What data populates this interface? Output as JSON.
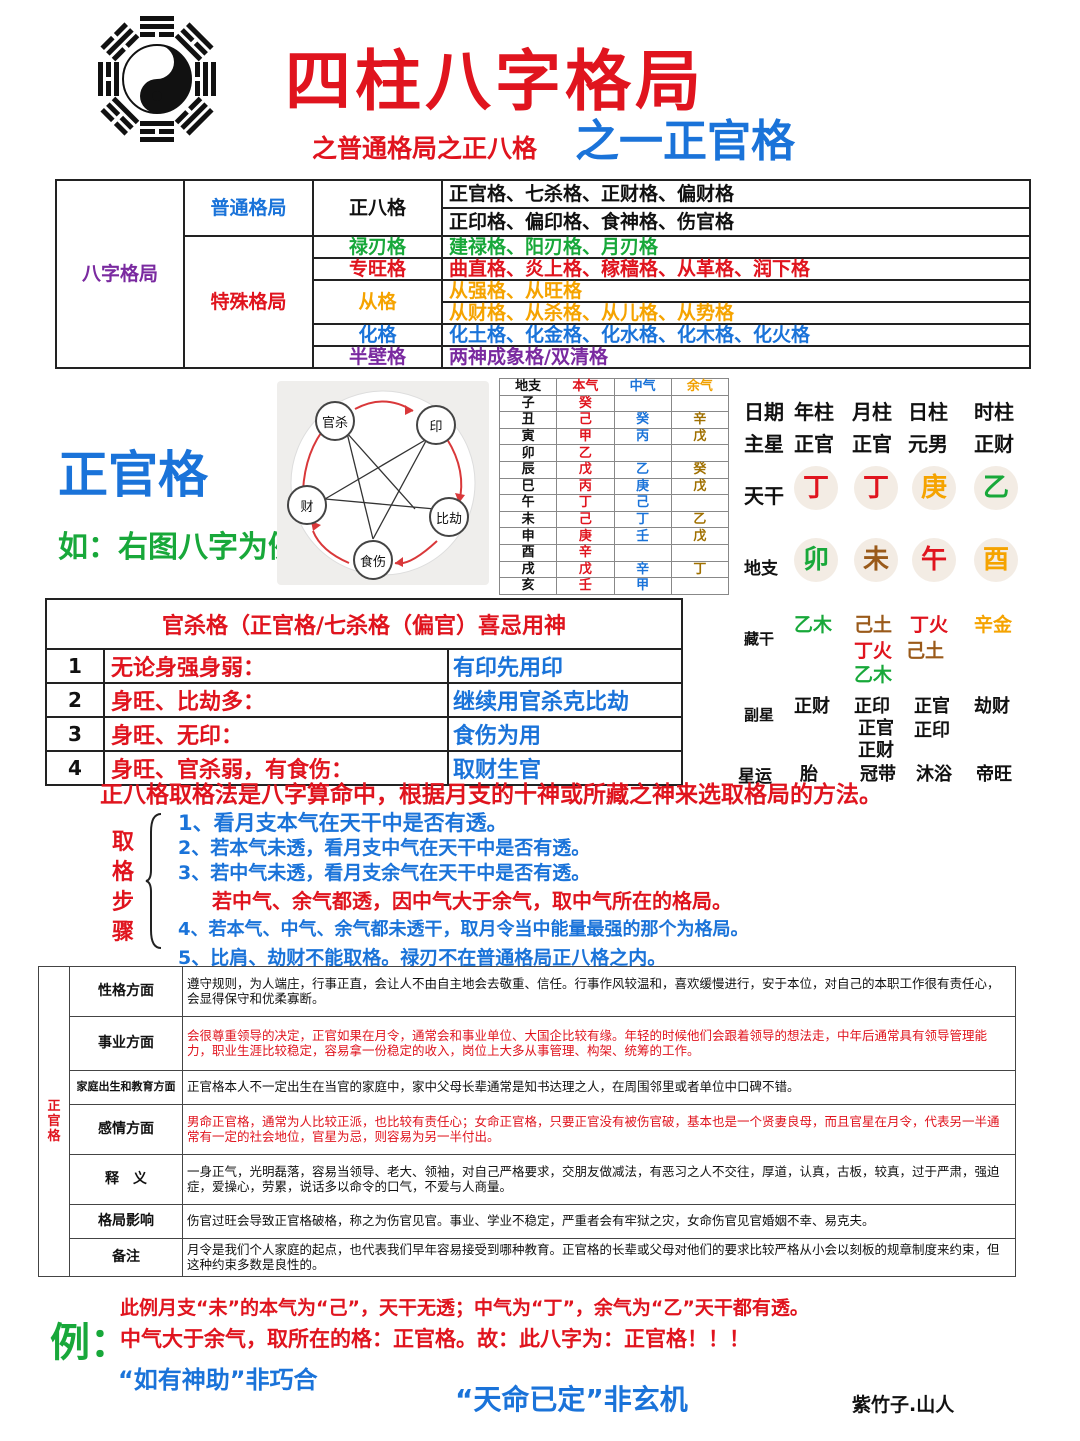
{
  "header": {
    "title": "四柱八字格局",
    "subtitle_left": "之普通格局之正八格",
    "subtitle_right": "之一正官格"
  },
  "classification": {
    "root": "八字格局",
    "ordinary": {
      "label": "普通格局",
      "sub": "正八格",
      "lines": [
        "正官格、七杀格、正财格、偏财格",
        "正印格、偏印格、食神格、伤官格"
      ]
    },
    "special": {
      "label": "特殊格局",
      "rows": [
        {
          "name": "禄刃格",
          "value": "建禄格、阳刃格、月刃格"
        },
        {
          "name": "专旺格",
          "value": "曲直格、炎上格、稼穑格、从革格、润下格"
        },
        {
          "name": "从格",
          "value1": "从强格、从旺格",
          "value2": "从财格、从杀格、从儿格、从势格"
        },
        {
          "name": "化格",
          "value": "化土格、化金格、化水格、化木格、化火格"
        },
        {
          "name": "半壁格",
          "value": "两神成象格/双清格"
        }
      ]
    }
  },
  "left_block": {
    "title": "正官格",
    "example": "如：右图八字为例"
  },
  "wheel": {
    "nodes": [
      "官杀",
      "印",
      "比劫",
      "食伤",
      "财"
    ]
  },
  "hidden_stems": {
    "headers": [
      "地支",
      "本气",
      "中气",
      "余气"
    ],
    "rows": [
      [
        "子",
        "癸",
        "",
        ""
      ],
      [
        "丑",
        "己",
        "癸",
        "辛"
      ],
      [
        "寅",
        "甲",
        "丙",
        "戊"
      ],
      [
        "卯",
        "乙",
        "",
        ""
      ],
      [
        "辰",
        "戊",
        "乙",
        "癸"
      ],
      [
        "巳",
        "丙",
        "庚",
        "戊"
      ],
      [
        "午",
        "丁",
        "己",
        ""
      ],
      [
        "未",
        "己",
        "丁",
        "乙"
      ],
      [
        "申",
        "庚",
        "壬",
        "戊"
      ],
      [
        "酉",
        "辛",
        "",
        ""
      ],
      [
        "戌",
        "戊",
        "辛",
        "丁"
      ],
      [
        "亥",
        "壬",
        "甲",
        ""
      ]
    ]
  },
  "chart": {
    "headers": [
      "日期",
      "年柱",
      "月柱",
      "日柱",
      "时柱"
    ],
    "main_star": [
      "主星",
      "正官",
      "正官",
      "元男",
      "正财"
    ],
    "tiangan_label": "天干",
    "tiangan": [
      "丁",
      "丁",
      "庚",
      "乙"
    ],
    "dizhi_label": "地支",
    "dizhi": [
      "卯",
      "未",
      "午",
      "酉"
    ],
    "canggan_label": "藏干",
    "canggan": [
      [
        "乙木"
      ],
      [
        "己土",
        "丁火",
        "乙木"
      ],
      [
        "丁火",
        "己土"
      ],
      [
        "辛金"
      ]
    ],
    "fuxing_label": "副星",
    "fuxing": [
      [
        "正财"
      ],
      [
        "正印",
        "正官",
        "正财"
      ],
      [
        "正官",
        "正印"
      ],
      [
        "劫财"
      ]
    ],
    "xingyun_label": "星运",
    "xingyun": [
      "胎",
      "冠带",
      "沐浴",
      "帝旺"
    ],
    "colors": {
      "fire": "#e0141e",
      "earth": "#9a5a1a",
      "metal": "#f5a300",
      "wood": "#18a83a"
    }
  },
  "xiji": {
    "title": "官杀格（正官格/七杀格（偏官）喜忌用神",
    "rows": [
      {
        "n": "1",
        "cond": "无论身强身弱：",
        "use": "有印先用印"
      },
      {
        "n": "2",
        "cond": "身旺、比劫多：",
        "use": "继续用官杀克比劫"
      },
      {
        "n": "3",
        "cond": "身旺、无印：",
        "use": "食伤为用"
      },
      {
        "n": "4",
        "cond": "身旺、官杀弱，有食伤：",
        "use": "取财生官"
      }
    ]
  },
  "method": {
    "headline": "正八格取格法是八字算命中，根据月支的十神或所藏之神来选取格局的方法。",
    "label": [
      "取",
      "格",
      "步",
      "骤"
    ],
    "steps": [
      "1、看月支本气在天干中是否有透。",
      "2、若本气未透，看月支中气在天干中是否有透。",
      "3、若中气未透，看月支余气在天干中是否有透。",
      "若中气、余气都透，因中气大于余气，取中气所在的格局。",
      "4、若本气、中气、余气都未透干，取月令当中能量最强的那个为格局。",
      "5、比肩、劫财不能取格。禄刃不在普通格局正八格之内。"
    ]
  },
  "traits": {
    "side": "正官格",
    "rows": [
      {
        "k": "性格方面",
        "v": "遵守规则，为人端庄，行事正直，会让人不由自主地会去敬重、信任。行事作风较温和，喜欢缓慢进行，安于本位，对自己的本职工作很有责任心，会显得保守和优柔寡断。"
      },
      {
        "k": "事业方面",
        "v": "会很尊重领导的决定，正官如果在月令，通常会和事业单位、大国企比较有缘。年轻的时候他们会跟着领导的想法走，中年后通常具有领导管理能力，职业生涯比较稳定，容易拿一份稳定的收入，岗位上大多从事管理、构架、统筹的工作。"
      },
      {
        "k": "家庭出生和教育方面",
        "v": "正官格本人不一定出生在当官的家庭中，家中父母长辈通常是知书达理之人，在周围邻里或者单位中口碑不错。"
      },
      {
        "k": "感情方面",
        "v": "男命正官格，通常为人比较正派，也比较有责任心；女命正官格，只要正官没有被伤官破，基本也是一个贤妻良母，而且官星在月令，代表另一半通常有一定的社会地位，官星为忌，则容易为另一半付出。"
      },
      {
        "k": "释　义",
        "v": "一身正气，光明磊落，容易当领导、老大、领袖，对自己严格要求，交朋友做减法，有恶习之人不交往，厚道，认真，古板，较真，过于严肃，强迫症，爱操心，劳累，说话多以命令的口气，不爱与人商量。"
      },
      {
        "k": "格局影响",
        "v": "伤官过旺会导致正官格破格，称之为伤官见官。事业、学业不稳定，严重者会有牢狱之灾，女命伤官见官婚姻不幸、易克夫。"
      },
      {
        "k": "备注",
        "v": "月令是我们个人家庭的起点，也代表我们早年容易接受到哪种教育。正官格的长辈或父母对他们的要求比较严格从小会以刻板的规章制度来约束，但这种约束多数是良性的。"
      }
    ]
  },
  "conclusion": {
    "label": "例：",
    "line1": "此例月支“未”的本气为“己”，天干无透；中气为“丁”，余气为“乙”天干都有透。",
    "line2": "中气大于余气，取所在的格：正官格。故：此八字为：正官格！！！",
    "quote1": "“如有神助”非巧合",
    "quote2": "“天命已定”非玄机",
    "author": "紫竹子.山人"
  }
}
